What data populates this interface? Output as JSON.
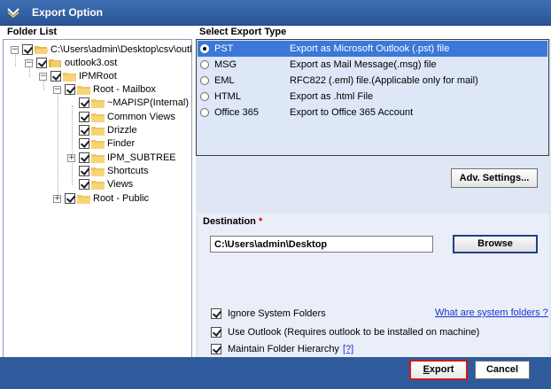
{
  "window": {
    "title": "Export Option"
  },
  "folder_list": {
    "header": "Folder List",
    "nodes": [
      {
        "label": "C:\\Users\\admin\\Desktop\\csv\\outlo",
        "expander": "−"
      },
      {
        "label": "outlook3.ost",
        "expander": "−"
      },
      {
        "label": "IPMRoot",
        "expander": "−"
      },
      {
        "label": "Root - Mailbox",
        "expander": "−"
      },
      {
        "label": "~MAPISP(Internal)",
        "expander": ""
      },
      {
        "label": "Common Views",
        "expander": ""
      },
      {
        "label": "Drizzle",
        "expander": ""
      },
      {
        "label": "Finder",
        "expander": ""
      },
      {
        "label": "IPM_SUBTREE",
        "expander": "+"
      },
      {
        "label": "Shortcuts",
        "expander": ""
      },
      {
        "label": "Views",
        "expander": ""
      },
      {
        "label": "Root - Public",
        "expander": "+"
      }
    ]
  },
  "export_type": {
    "header": "Select Export Type",
    "selected": "PST",
    "options": [
      {
        "name": "PST",
        "desc": "Export as Microsoft Outlook (.pst) file"
      },
      {
        "name": "MSG",
        "desc": "Export as Mail Message(.msg) file"
      },
      {
        "name": "EML",
        "desc": "RFC822 (.eml) file.(Applicable only for mail)"
      },
      {
        "name": "HTML",
        "desc": "Export as .html File"
      },
      {
        "name": "Office 365",
        "desc": "Export to Office 365 Account"
      }
    ]
  },
  "adv_settings_label": "Adv. Settings...",
  "destination": {
    "label": "Destination",
    "required_mark": "*",
    "path": "C:\\Users\\admin\\Desktop",
    "browse_label": "Browse"
  },
  "options": {
    "ignore_system_folders": {
      "label": "Ignore System Folders",
      "checked": true
    },
    "system_folders_link": "What are system folders ?",
    "use_outlook": {
      "label": "Use Outlook (Requires outlook to be installed on machine)",
      "checked": true
    },
    "maintain_hierarchy": {
      "label": "Maintain Folder Hierarchy",
      "checked": true,
      "help": "[?]"
    }
  },
  "footer": {
    "export_label_first": "E",
    "export_label_rest": "xport",
    "cancel_label": "Cancel"
  },
  "colors": {
    "titlebar": "#2f5a9c",
    "selection": "#3b78d8",
    "export_border": "#cc1a1a"
  }
}
